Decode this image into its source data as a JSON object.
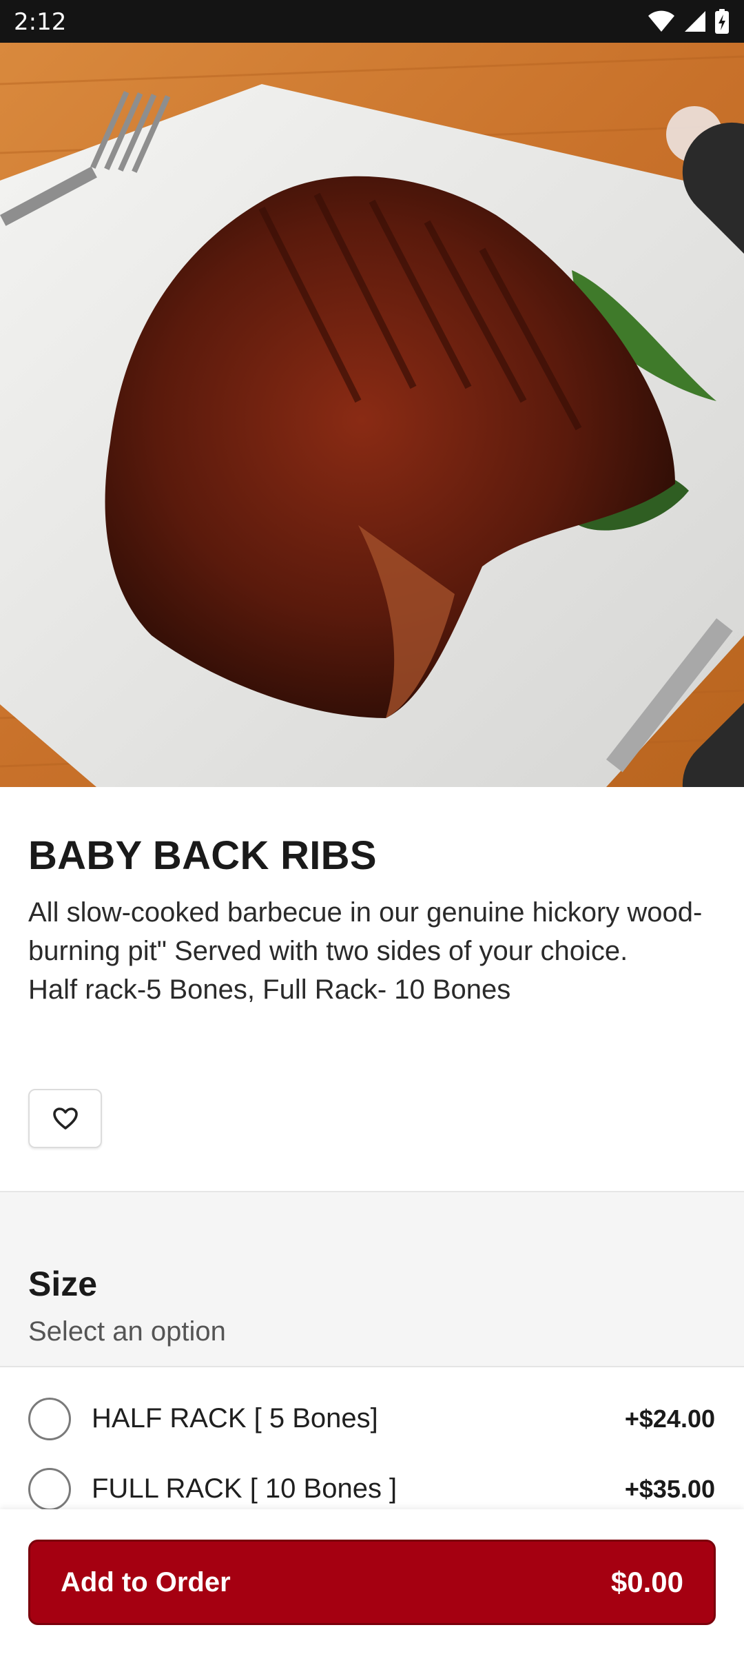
{
  "status_bar": {
    "time": "2:12",
    "icons": [
      "wifi-icon",
      "cellular-signal-icon",
      "battery-charging-icon"
    ]
  },
  "hero": {
    "image": "barbecue-ribs-on-plate-photo",
    "close_icon": "close-icon"
  },
  "item": {
    "title": "BABY BACK RIBS",
    "description_line1": "All slow-cooked barbecue in our genuine hickory wood-burning pit\" Served with two sides of your choice.",
    "description_line2": "Half rack-5 Bones, Full Rack- 10 Bones",
    "favorite_icon": "heart-icon"
  },
  "size_section": {
    "title": "Size",
    "subtitle": "Select an option",
    "options": [
      {
        "label": "HALF RACK [ 5 Bones]",
        "price": "+$24.00",
        "selected": false
      },
      {
        "label": "FULL RACK [ 10 Bones ]",
        "price": "+$35.00",
        "selected": false
      }
    ]
  },
  "footer": {
    "add_label": "Add to Order",
    "total": "$0.00"
  },
  "colors": {
    "accent": "#a50011",
    "status_bar": "#141414",
    "section_bg": "#f5f5f5"
  }
}
